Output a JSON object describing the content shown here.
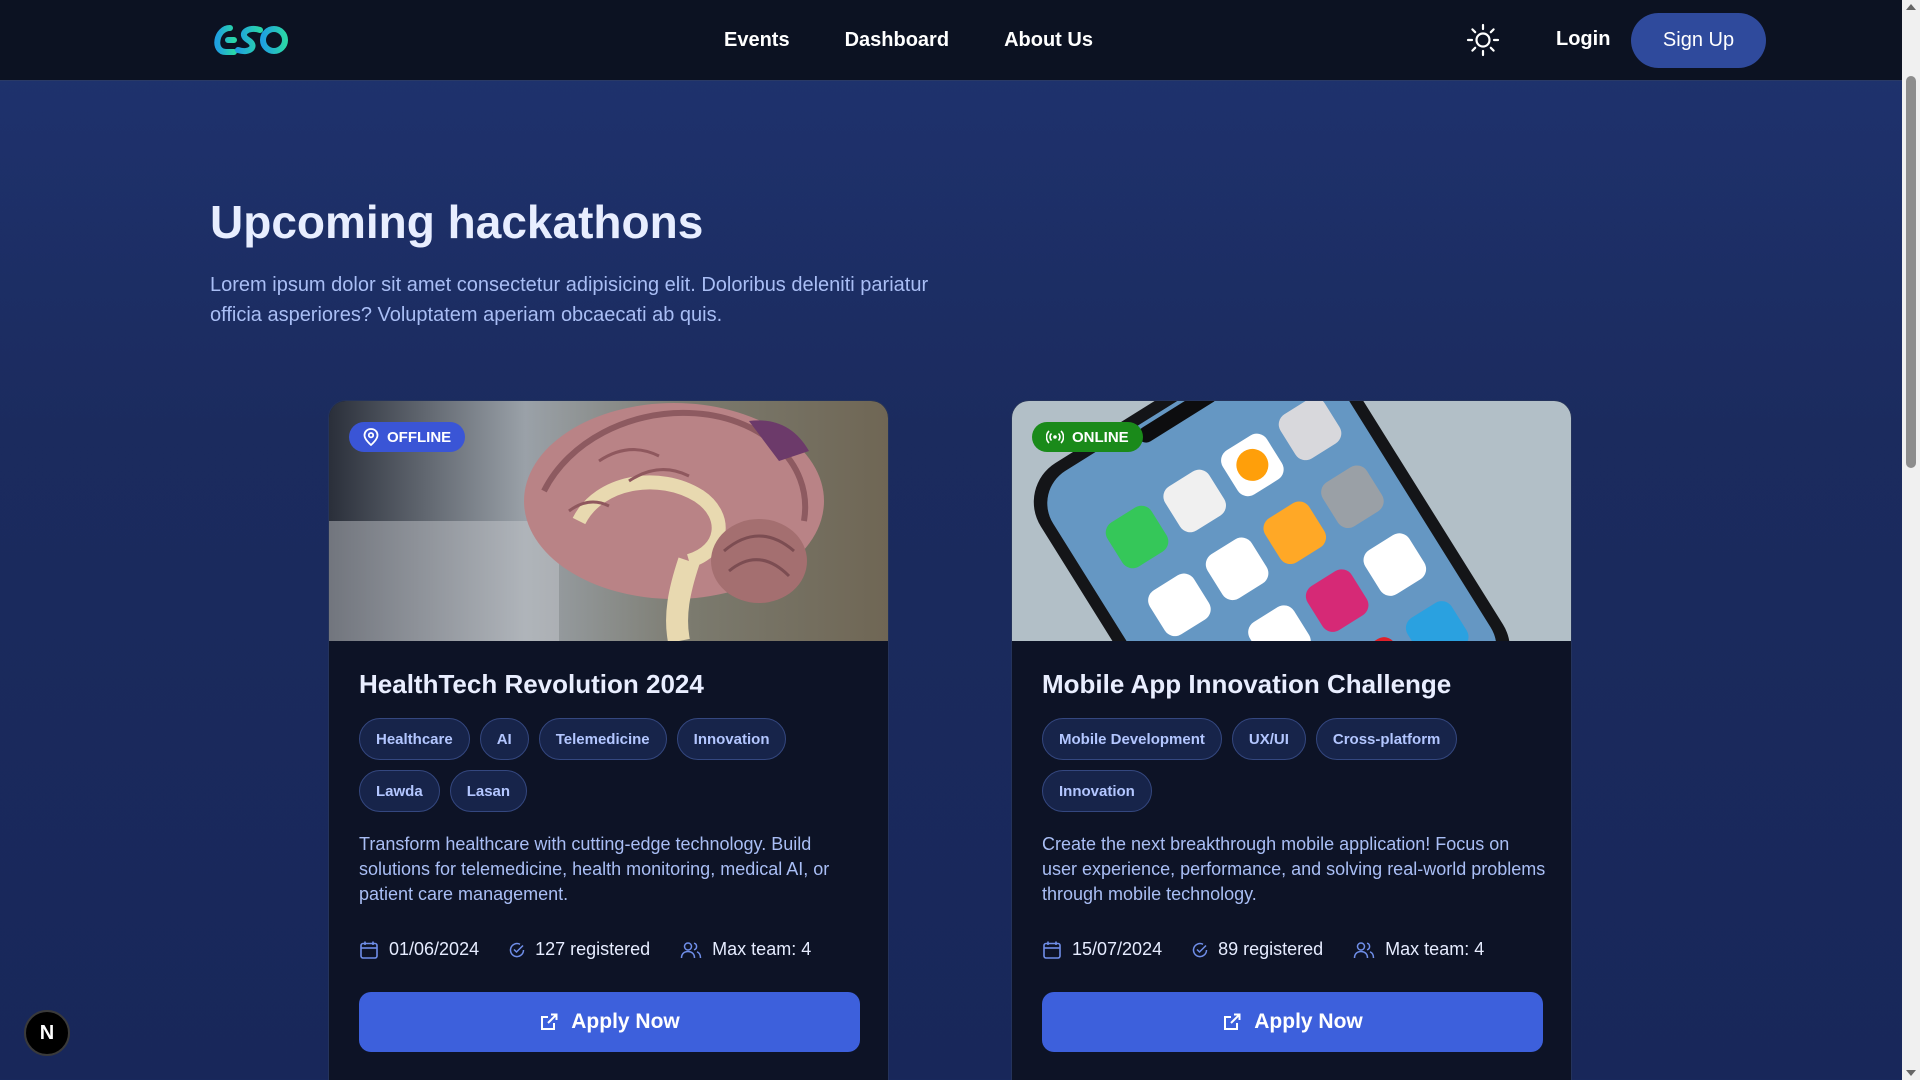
{
  "nav": {
    "links": [
      "Events",
      "Dashboard",
      "About Us"
    ],
    "login_label": "Login",
    "signup_label": "Sign Up"
  },
  "hero": {
    "title": "Upcoming hackathons",
    "description": "Lorem ipsum dolor sit amet consectetur adipisicing elit. Doloribus deleniti pariatur officia asperiores? Voluptatem aperiam obcaecati ab quis."
  },
  "cards": [
    {
      "badge": "OFFLINE",
      "image_icon": "brain-model-image",
      "title": "HealthTech Revolution 2024",
      "tags": [
        "Healthcare",
        "AI",
        "Telemedicine",
        "Innovation",
        "Lawda",
        "Lasan"
      ],
      "description": "Transform healthcare with cutting-edge technology. Build solutions for telemedicine, health monitoring, medical AI, or patient care management.",
      "date": "01/06/2024",
      "registered": "127 registered",
      "max_team": "Max team: 4",
      "apply_label": "Apply Now"
    },
    {
      "badge": "ONLINE",
      "image_icon": "smartphone-apps-image",
      "title": "Mobile App Innovation Challenge",
      "tags": [
        "Mobile Development",
        "UX/UI",
        "Cross-platform",
        "Innovation"
      ],
      "description": "Create the next breakthrough mobile application! Focus on user experience, performance, and solving real-world problems through mobile technology.",
      "date": "15/07/2024",
      "registered": "89 registered",
      "max_team": "Max team: 4",
      "apply_label": "Apply Now"
    }
  ],
  "dev_indicator": "N",
  "colors": {
    "nav_bg": "#0c1222",
    "page_bg": "#1f3370",
    "card_bg": "#0d1326",
    "accent": "#3d60dc",
    "offline_badge": "#3a55d6",
    "online_badge": "#1a8a1a",
    "text_muted": "#a9bef5"
  }
}
